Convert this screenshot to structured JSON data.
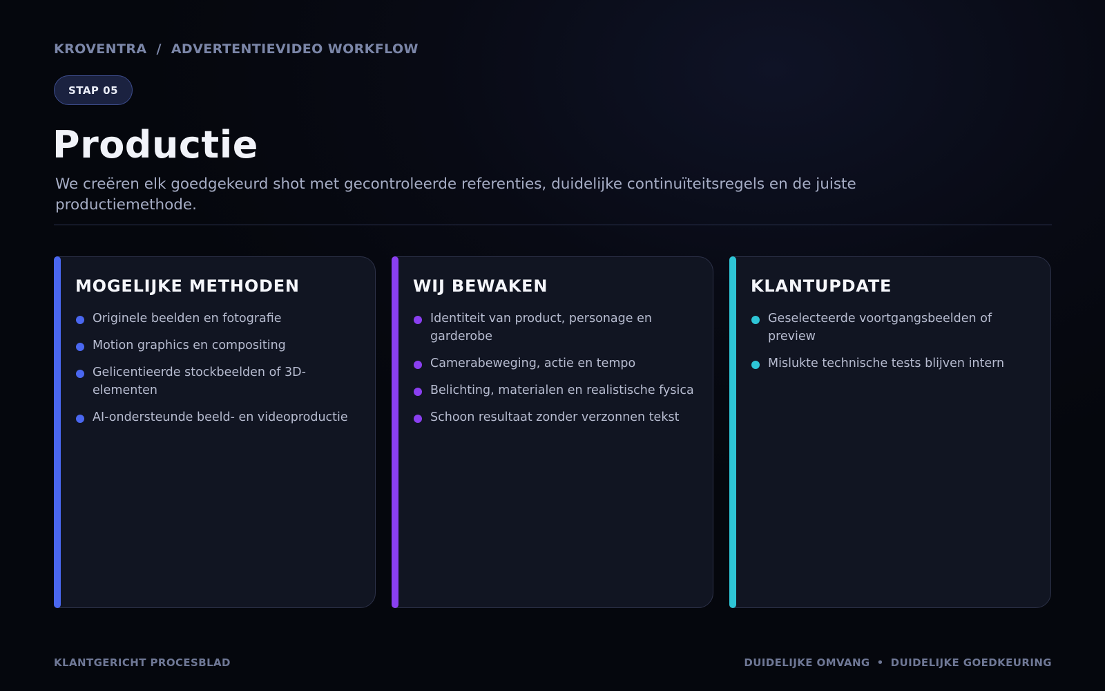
{
  "breadcrumb": {
    "brand": "KROVENTRA",
    "separator": "/",
    "section": "ADVERTENTIEVIDEO WORKFLOW"
  },
  "badge": "STAP 05",
  "title": "Productie",
  "subtitle": "We creëren elk goedgekeurd shot met gecontroleerde referenties, duidelijke continuïteitsregels en de juiste productiemethode.",
  "cards": [
    {
      "title": "MOGELIJKE METHODEN",
      "accent": "#4a67f0",
      "items": [
        "Originele beelden en fotografie",
        "Motion graphics en compositing",
        "Gelicentieerde stockbeelden of 3D-elementen",
        "AI-ondersteunde beeld- en videoproductie"
      ]
    },
    {
      "title": "WIJ BEWAKEN",
      "accent": "#8a3ff0",
      "items": [
        "Identiteit van product, personage en garderobe",
        "Camerabeweging, actie en tempo",
        "Belichting, materialen en realistische fysica",
        "Schoon resultaat zonder verzonnen tekst"
      ]
    },
    {
      "title": "KLANTUPDATE",
      "accent": "#2ec5d6",
      "items": [
        "Geselecteerde voortgangsbeelden of preview",
        "Mislukte technische tests blijven intern"
      ]
    }
  ],
  "footer": {
    "left": "KLANTGERICHT PROCESBLAD",
    "right_1": "DUIDELIJKE OMVANG",
    "right_separator": "•",
    "right_2": "DUIDELIJKE GOEDKEURING"
  }
}
